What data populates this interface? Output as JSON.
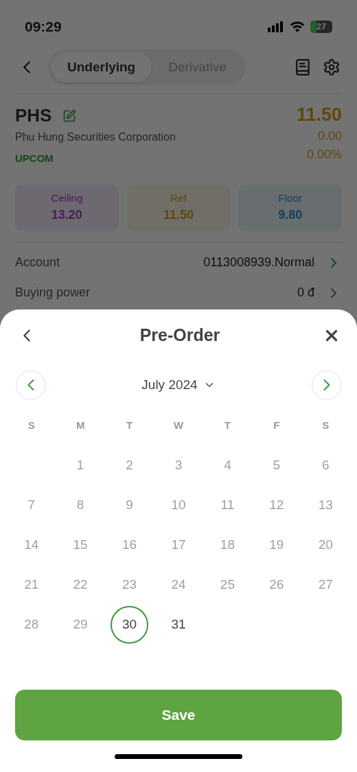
{
  "status_bar": {
    "time": "09:29",
    "battery": "27"
  },
  "header": {
    "tabs": [
      {
        "label": "Underlying",
        "selected": true
      },
      {
        "label": "Derivative",
        "selected": false
      }
    ]
  },
  "stock": {
    "symbol": "PHS",
    "name": "Phu Hung Securities Corporation",
    "exchange": "UPCOM",
    "price": "11.50",
    "change": "0.00",
    "change_percent": "0.00%"
  },
  "price_cards": [
    {
      "label": "Ceiling",
      "value": "13.20",
      "kind": "ceiling"
    },
    {
      "label": "Ref",
      "value": "11.50",
      "kind": "reference"
    },
    {
      "label": "Floor",
      "value": "9.80",
      "kind": "floor"
    }
  ],
  "info_rows": [
    {
      "label": "Account",
      "value": "0113008939.Normal"
    },
    {
      "label": "Buying power",
      "value": "0 đ"
    }
  ],
  "sheet": {
    "title": "Pre-Order",
    "month": "July 2024",
    "weekdays": [
      "S",
      "M",
      "T",
      "W",
      "T",
      "F",
      "S"
    ],
    "weeks": [
      [
        {
          "day": "1",
          "disabled": true,
          "selected": false
        },
        {
          "day": "2",
          "disabled": true,
          "selected": false
        },
        {
          "day": "3",
          "disabled": true,
          "selected": false
        },
        {
          "day": "4",
          "disabled": true,
          "selected": false
        },
        {
          "day": "5",
          "disabled": true,
          "selected": false
        },
        {
          "day": "6",
          "disabled": true,
          "selected": false
        }
      ],
      [
        {
          "day": "7",
          "disabled": true,
          "selected": false
        },
        {
          "day": "8",
          "disabled": true,
          "selected": false
        },
        {
          "day": "9",
          "disabled": true,
          "selected": false
        },
        {
          "day": "10",
          "disabled": true,
          "selected": false
        },
        {
          "day": "11",
          "disabled": true,
          "selected": false
        },
        {
          "day": "12",
          "disabled": true,
          "selected": false
        },
        {
          "day": "13",
          "disabled": true,
          "selected": false
        }
      ],
      [
        {
          "day": "14",
          "disabled": true,
          "selected": false
        },
        {
          "day": "15",
          "disabled": true,
          "selected": false
        },
        {
          "day": "16",
          "disabled": true,
          "selected": false
        },
        {
          "day": "17",
          "disabled": true,
          "selected": false
        },
        {
          "day": "18",
          "disabled": true,
          "selected": false
        },
        {
          "day": "19",
          "disabled": true,
          "selected": false
        },
        {
          "day": "20",
          "disabled": true,
          "selected": false
        }
      ],
      [
        {
          "day": "21",
          "disabled": true,
          "selected": false
        },
        {
          "day": "22",
          "disabled": true,
          "selected": false
        },
        {
          "day": "23",
          "disabled": true,
          "selected": false
        },
        {
          "day": "24",
          "disabled": true,
          "selected": false
        },
        {
          "day": "25",
          "disabled": true,
          "selected": false
        },
        {
          "day": "26",
          "disabled": true,
          "selected": false
        },
        {
          "day": "27",
          "disabled": true,
          "selected": false
        }
      ],
      [
        {
          "day": "28",
          "disabled": true,
          "selected": false
        },
        {
          "day": "29",
          "disabled": true,
          "selected": false
        },
        {
          "day": "30",
          "disabled": false,
          "selected": true
        },
        {
          "day": "31",
          "disabled": false,
          "selected": false
        }
      ]
    ],
    "save_label": "Save"
  }
}
